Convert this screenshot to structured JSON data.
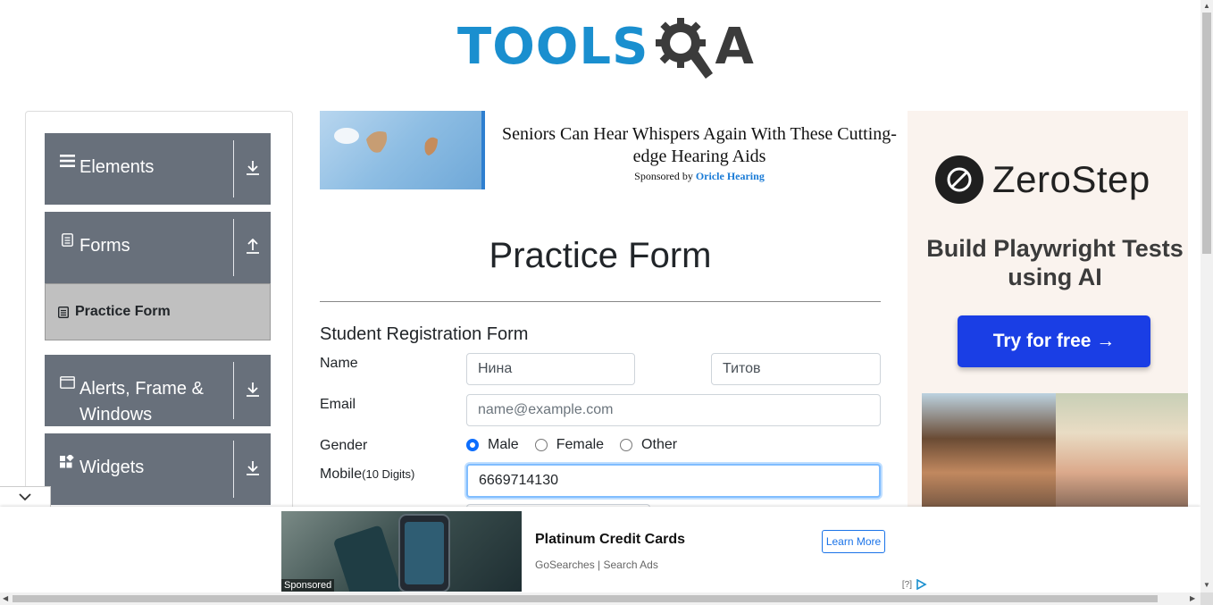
{
  "header": {
    "logo_tools": "TOOLS",
    "logo_qa": "A"
  },
  "sidebar": {
    "groups": [
      {
        "label": "Elements",
        "icon": "hamburger-icon",
        "arrow": "download-icon"
      },
      {
        "label": "Forms",
        "icon": "document-icon",
        "arrow": "upload-icon"
      },
      {
        "label": "Alerts, Frame & Windows",
        "icon": "window-icon",
        "arrow": "download-icon"
      },
      {
        "label": "Widgets",
        "icon": "widgets-icon",
        "arrow": "download-icon"
      }
    ],
    "active_item": {
      "label": "Practice Form",
      "icon": "form-icon"
    }
  },
  "top_ad": {
    "title": "Seniors Can Hear Whispers Again With These Cutting-edge Hearing Aids",
    "sponsored_prefix": "Sponsored by",
    "sponsor": "Oricle Hearing"
  },
  "main": {
    "title": "Practice Form",
    "form_title": "Student Registration Form",
    "labels": {
      "name": "Name",
      "email": "Email",
      "gender": "Gender",
      "mobile": "Mobile",
      "mobile_hint": "(10 Digits)"
    },
    "fields": {
      "first_name": "Нина",
      "last_name": "Титов",
      "email_placeholder": "name@example.com",
      "mobile": "6669714130"
    },
    "gender_options": [
      {
        "label": "Male",
        "checked": true
      },
      {
        "label": "Female",
        "checked": false
      },
      {
        "label": "Other",
        "checked": false
      }
    ]
  },
  "right_ad": {
    "brand": "ZeroStep",
    "tagline": "Build Playwright Tests using AI",
    "cta": "Try for free →"
  },
  "bottom_ad": {
    "title": "Platinum Credit Cards",
    "source": "GoSearches | Search Ads",
    "button": "Learn More",
    "sponsored": "Sponsored",
    "info": "[?]"
  },
  "colors": {
    "accent": "#1a8fcf",
    "sidebar": "#68707b",
    "cta": "#1a3ee5"
  }
}
